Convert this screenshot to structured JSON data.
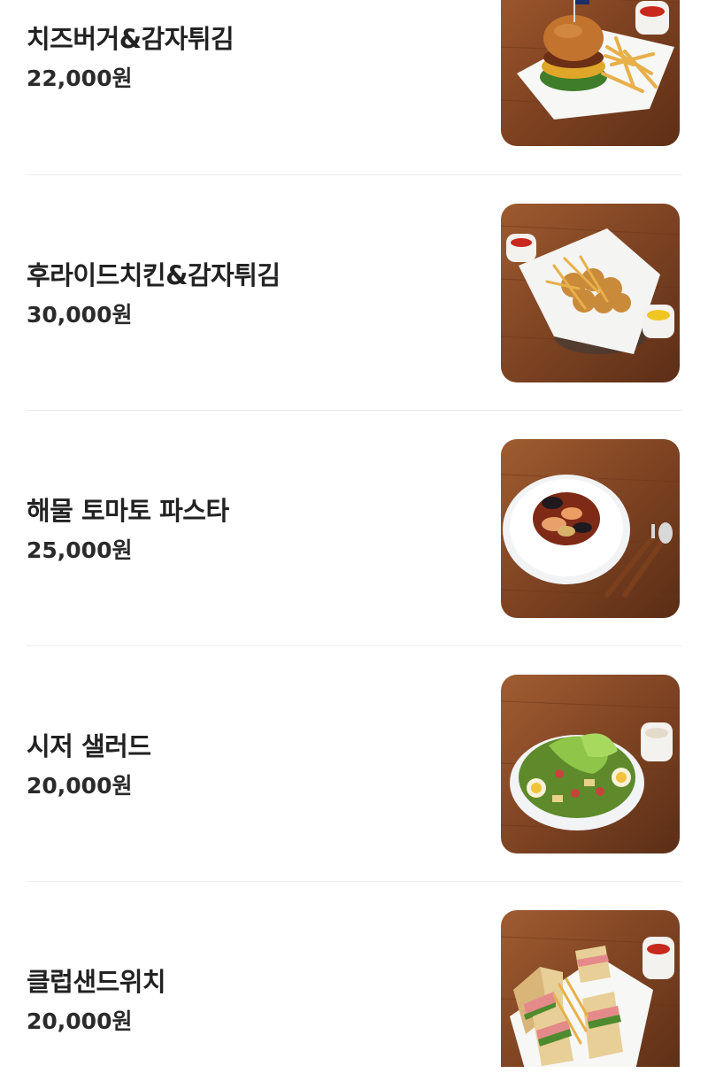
{
  "menu": {
    "items": [
      {
        "name": "치즈버거&감자튀김",
        "price": "22,000원",
        "image": "cheeseburger-fries-photo"
      },
      {
        "name": "후라이드치킨&감자튀김",
        "price": "30,000원",
        "image": "fried-chicken-fries-photo"
      },
      {
        "name": "해물 토마토 파스타",
        "price": "25,000원",
        "image": "seafood-tomato-pasta-photo"
      },
      {
        "name": "시저 샐러드",
        "price": "20,000원",
        "image": "caesar-salad-photo"
      },
      {
        "name": "클럽샌드위치",
        "price": "20,000원",
        "image": "club-sandwich-photo"
      }
    ]
  },
  "colors": {
    "text": "#222222",
    "divider": "#ececec",
    "wood": "#8a4a26"
  }
}
